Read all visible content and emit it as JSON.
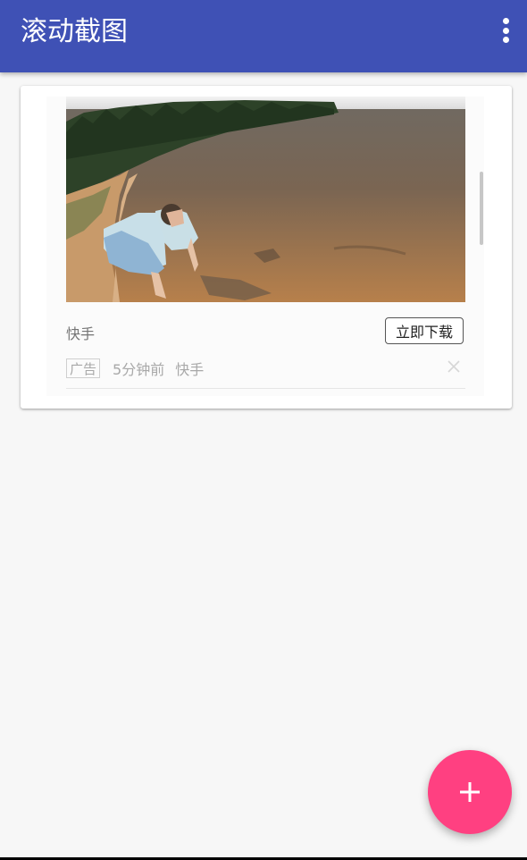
{
  "appbar": {
    "title": "滚动截图",
    "menu_icon": "more-vert-icon"
  },
  "ad": {
    "image_description_icon": "video-thumbnail",
    "source": "快手",
    "download_label": "立即下载",
    "badge": "广告",
    "time": "5分钟前",
    "publisher": "快手",
    "close_icon": "close-icon"
  },
  "fab": {
    "icon": "add-icon"
  },
  "colors": {
    "primary": "#3f51b5",
    "accent": "#ff4081",
    "background": "#f7f7f7"
  }
}
